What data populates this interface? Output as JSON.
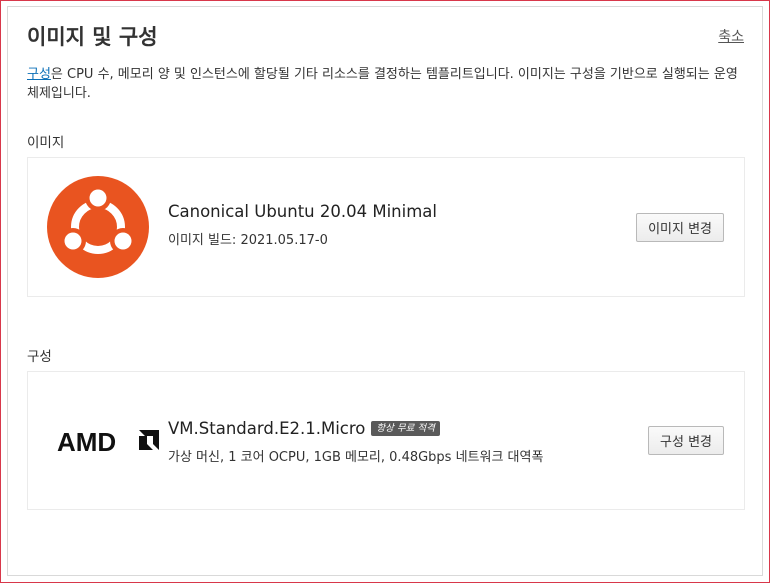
{
  "header": {
    "title": "이미지 및 구성",
    "collapse_label": "축소"
  },
  "description": {
    "link_text": "구성",
    "text": "은 CPU 수, 메모리 양 및 인스턴스에 할당될 기타 리소스를 결정하는 템플리트입니다. 이미지는 구성을 기반으로 실행되는 운영체제입니다."
  },
  "image_section": {
    "label": "이미지",
    "name": "Canonical Ubuntu 20.04 Minimal",
    "build": "이미지 빌드: 2021.05.17-0",
    "change_button": "이미지 변경",
    "logo_color": "#e95420"
  },
  "shape_section": {
    "label": "구성",
    "name": "VM.Standard.E2.1.Micro",
    "badge": "항상 무료 적격",
    "specs": "가상 머신, 1 코어 OCPU, 1GB 메모리, 0.48Gbps 네트워크 대역폭",
    "change_button": "구성 변경",
    "logo_text": "AMD"
  },
  "colors": {
    "link": "#0b6fb7",
    "frame": "#d8374a"
  }
}
